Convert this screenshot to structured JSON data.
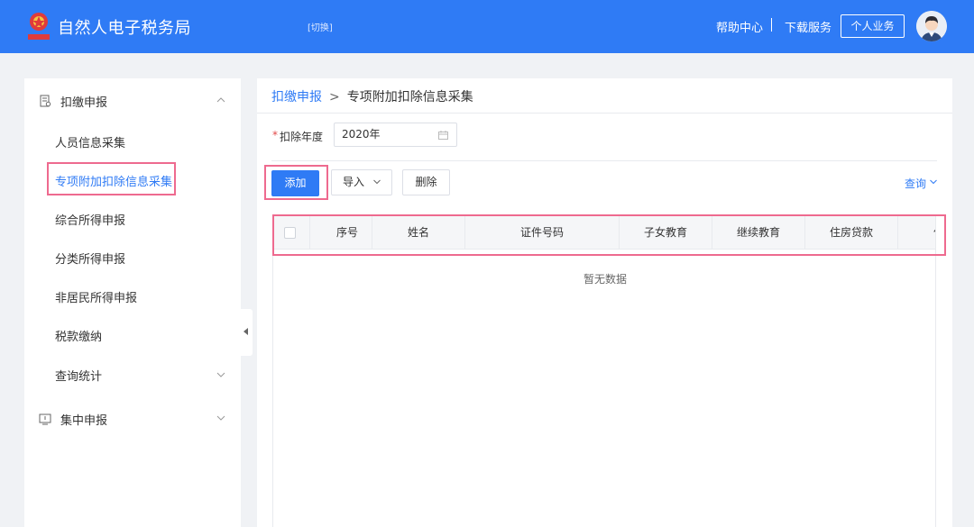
{
  "header": {
    "app_title": "自然人电子税务局",
    "switch_label": "[切换]",
    "help_center": "帮助中心",
    "download_service": "下载服务",
    "personal_business": "个人业务",
    "logo_icon": "tax-emblem-icon",
    "avatar_icon": "user-avatar-icon"
  },
  "sidebar": {
    "groups": [
      {
        "label": "扣缴申报",
        "icon": "document-icon",
        "expanded": true
      },
      {
        "label": "集中申报",
        "icon": "monitor-icon",
        "expanded": false
      }
    ],
    "items": [
      {
        "label": "人员信息采集"
      },
      {
        "label": "专项附加扣除信息采集",
        "active": true
      },
      {
        "label": "综合所得申报"
      },
      {
        "label": "分类所得申报"
      },
      {
        "label": "非居民所得申报"
      },
      {
        "label": "税款缴纳"
      },
      {
        "label": "查询统计"
      }
    ]
  },
  "breadcrumb": {
    "root": "扣缴申报",
    "separator": ">",
    "current": "专项附加扣除信息采集"
  },
  "form": {
    "required_mark": "*",
    "year_label": "扣除年度",
    "year_value": "2020年"
  },
  "toolbar": {
    "add_label": "添加",
    "import_label": "导入",
    "delete_label": "删除",
    "query_label": "查询"
  },
  "table": {
    "columns": [
      "序号",
      "姓名",
      "证件号码",
      "子女教育",
      "继续教育",
      "住房贷款",
      "住房"
    ],
    "empty_text": "暂无数据"
  },
  "colors": {
    "primary": "#2f7bf5",
    "highlight": "#ee6a8f"
  }
}
